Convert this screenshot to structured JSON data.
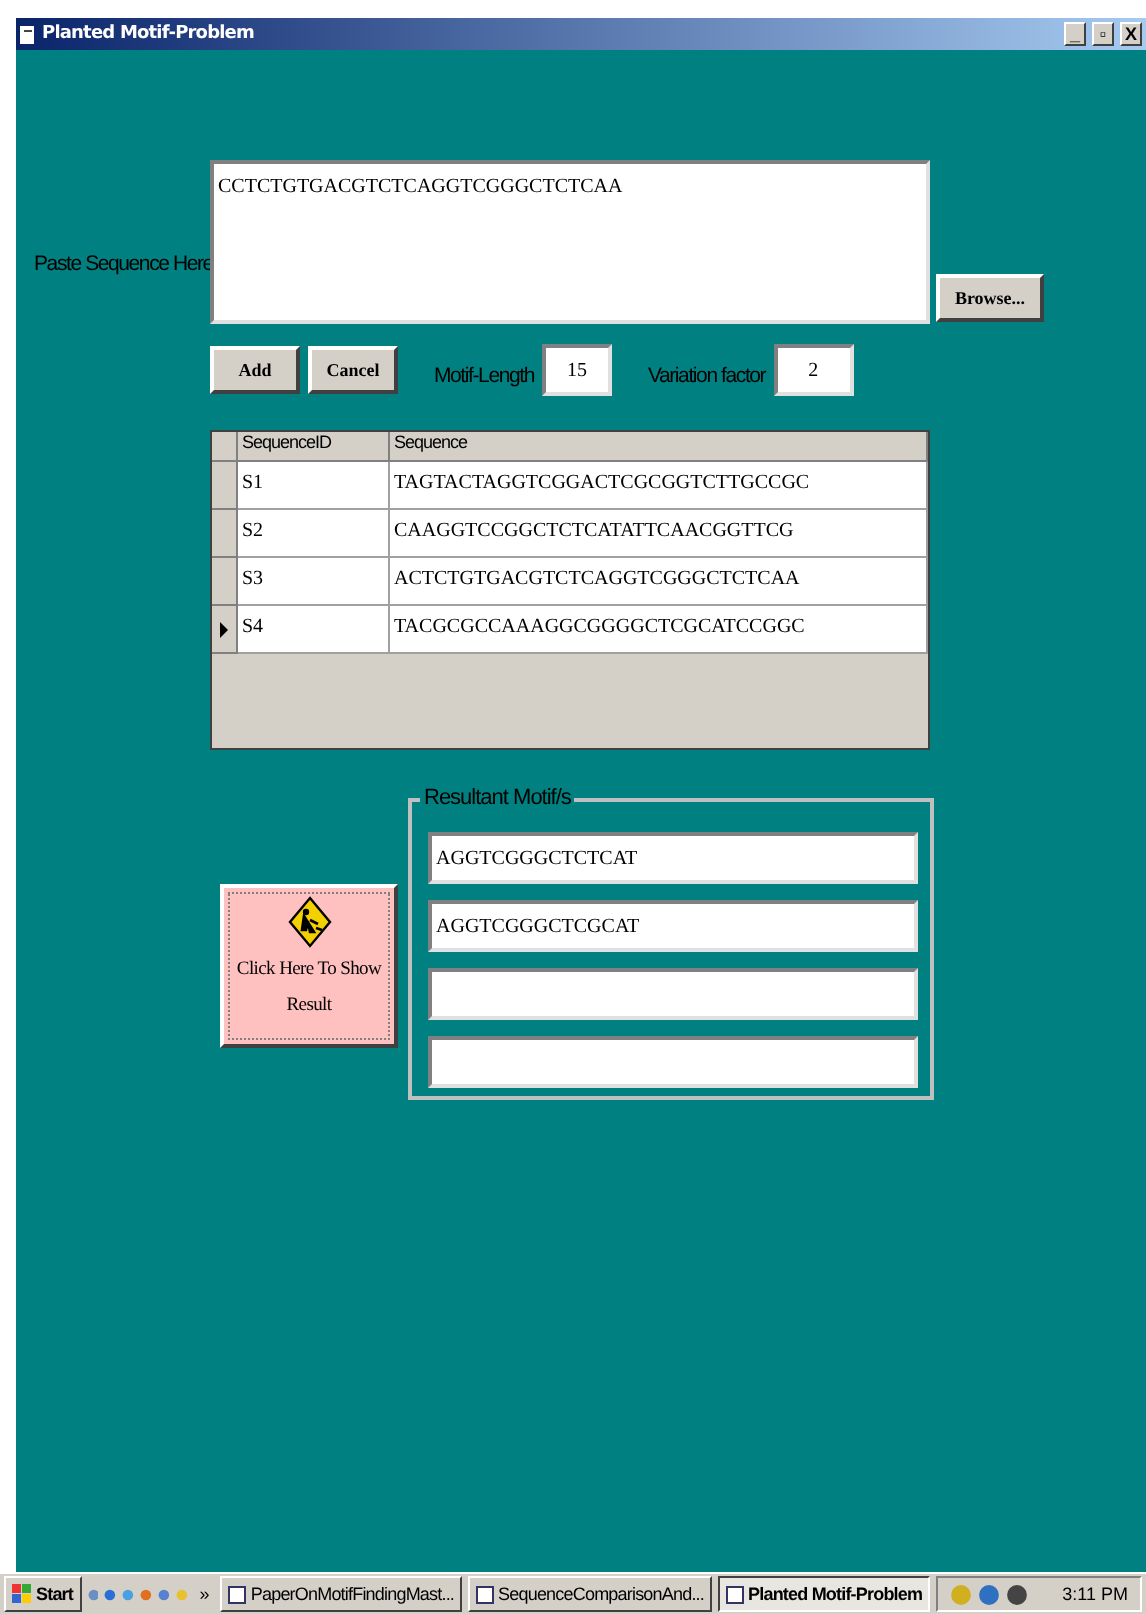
{
  "window": {
    "title": "Planted Motif-Problem",
    "controls": [
      "_",
      "▫",
      "X"
    ]
  },
  "input": {
    "label": "Paste Sequence Here",
    "value": "CCTCTGTGACGTCTCAGGTCGGGCTCTCAA",
    "browse": "Browse..."
  },
  "actions": {
    "add": "Add",
    "cancel": "Cancel",
    "motif_length_label": "Motif-Length",
    "motif_length": "15",
    "variation_label": "Variation factor",
    "variation": "2"
  },
  "table": {
    "columns": [
      "SequenceID",
      "Sequence"
    ],
    "rows": [
      {
        "id": "S1",
        "sequence": "TAGTACTAGGTCGGACTCGCGGTCTTGCCGC",
        "selected": false
      },
      {
        "id": "S2",
        "sequence": "CAAGGTCCGGCTCTCATATTCAACGGTTCG",
        "selected": false
      },
      {
        "id": "S3",
        "sequence": "ACTCTGTGACGTCTCAGGTCGGGCTCTCAA",
        "selected": false
      },
      {
        "id": "S4",
        "sequence": "TACGCGCCAAAGGCGGGGCTCGCATCCGGC",
        "selected": true
      }
    ]
  },
  "show_result": "Click Here To Show Result",
  "results": {
    "title": "Resultant Motif/s",
    "motifs": [
      {
        "kind": "filled",
        "text": "AGGTCGGGCTCTCAT"
      },
      {
        "kind": "filled",
        "text": "AGGTCGGGCTCGCAT"
      },
      {
        "kind": "empty"
      },
      {
        "kind": "empty"
      }
    ]
  },
  "taskbar": {
    "start": "Start",
    "more": "»",
    "tasks": [
      {
        "label": "PaperOnMotifFindingMast...",
        "selected": false
      },
      {
        "label": "SequenceComparisonAnd...",
        "selected": false
      },
      {
        "label": "Planted Motif-Problem",
        "selected": true
      }
    ],
    "clock": "3:11 PM"
  }
}
